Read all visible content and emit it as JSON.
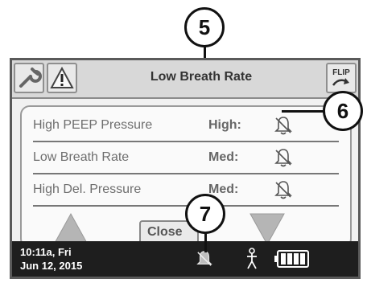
{
  "header": {
    "title": "Low Breath Rate",
    "flip_label": "FLIP"
  },
  "alarms": [
    {
      "name": "High PEEP Pressure",
      "level": "High:"
    },
    {
      "name": "Low Breath Rate",
      "level": "Med:"
    },
    {
      "name": "High Del. Pressure",
      "level": "Med:"
    }
  ],
  "buttons": {
    "close_label": "Close"
  },
  "status": {
    "time": "10:11a, Fri",
    "date": "Jun 12, 2015"
  },
  "callouts": {
    "c5": "5",
    "c6": "6",
    "c7": "7"
  },
  "icons": [
    "wrench-icon",
    "warning-icon",
    "flip-icon",
    "alarm-silenced-bell-icon",
    "up-arrow-icon",
    "down-arrow-icon",
    "person-icon",
    "battery-icon"
  ]
}
